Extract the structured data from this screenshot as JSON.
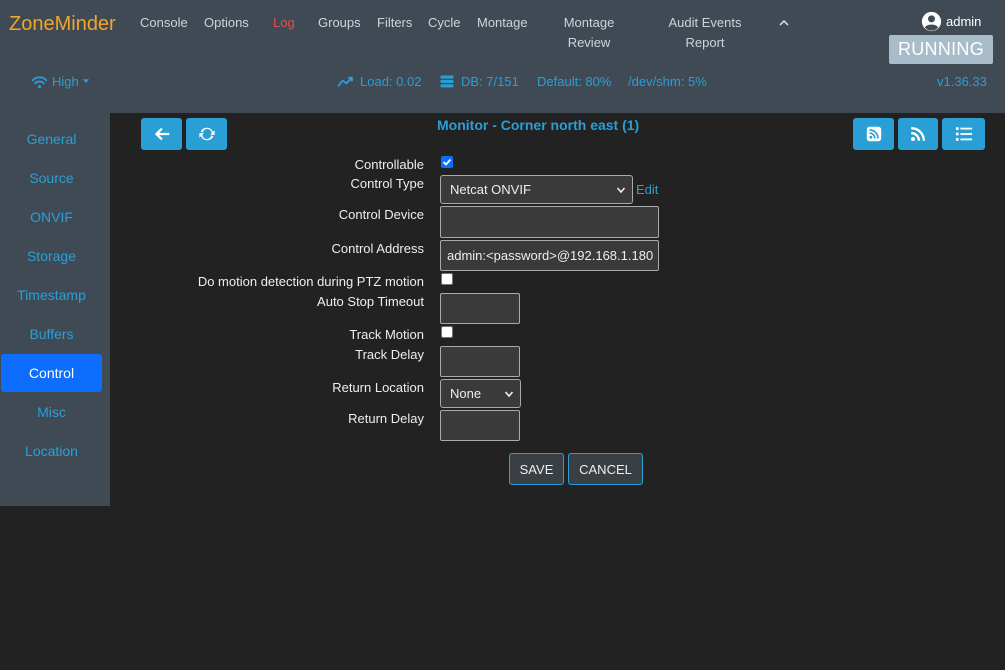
{
  "brand": "ZoneMinder",
  "nav": {
    "console": "Console",
    "options": "Options",
    "log": "Log",
    "groups": "Groups",
    "filters": "Filters",
    "cycle": "Cycle",
    "montage": "Montage",
    "montage_review": "Montage Review",
    "audit_events_report": "Audit Events Report"
  },
  "user": "admin",
  "state": "RUNNING",
  "status": {
    "bandwidth": "High",
    "load": "Load: 0.02",
    "db": "DB: 7/151",
    "default_storage": "Default: 80%",
    "shm": "/dev/shm: 5%",
    "version": "v1.36.33"
  },
  "sidebar": {
    "items": [
      {
        "label": "General"
      },
      {
        "label": "Source"
      },
      {
        "label": "ONVIF"
      },
      {
        "label": "Storage"
      },
      {
        "label": "Timestamp"
      },
      {
        "label": "Buffers"
      },
      {
        "label": "Control",
        "active": true
      },
      {
        "label": "Misc"
      },
      {
        "label": "Location"
      }
    ]
  },
  "page_title": "Monitor - Corner north east (1)",
  "form": {
    "controllable": {
      "label": "Controllable",
      "checked": true
    },
    "control_type": {
      "label": "Control Type",
      "value": "Netcat ONVIF",
      "edit": "Edit"
    },
    "control_device": {
      "label": "Control Device",
      "value": ""
    },
    "control_address": {
      "label": "Control Address",
      "value": "admin:<password>@192.168.1.180"
    },
    "motion_ptz": {
      "label": "Do motion detection during PTZ motion",
      "checked": false
    },
    "auto_stop_timeout": {
      "label": "Auto Stop Timeout",
      "value": ""
    },
    "track_motion": {
      "label": "Track Motion",
      "checked": false
    },
    "track_delay": {
      "label": "Track Delay",
      "value": ""
    },
    "return_location": {
      "label": "Return Location",
      "value": "None"
    },
    "return_delay": {
      "label": "Return Delay",
      "value": ""
    }
  },
  "buttons": {
    "save": "SAVE",
    "cancel": "CANCEL"
  },
  "colors": {
    "accent": "#2a9fd6",
    "brand": "#f3a52b",
    "navbar": "#3f4a55",
    "active": "#0d6efd"
  }
}
